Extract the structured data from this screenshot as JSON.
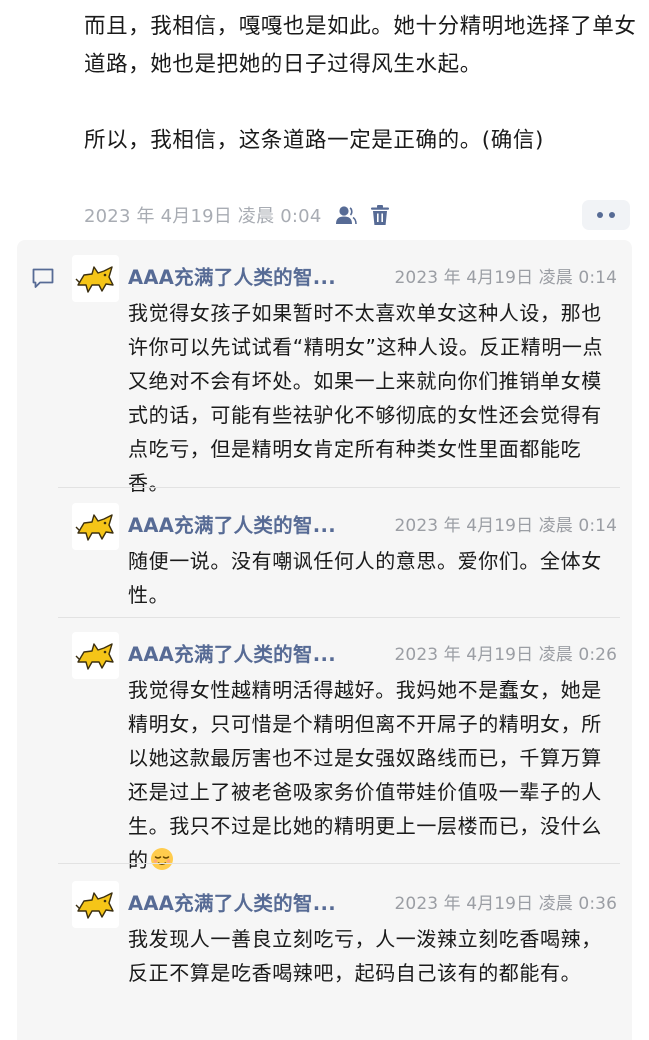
{
  "post": {
    "paragraph_1": "而且，我相信，嘎嘎也是如此。她十分精明地选择了单女道路，她也是把她的日子过得风生水起。",
    "paragraph_2": "所以，我相信，这条道路一定是正确的。(确信)",
    "timestamp": "2023 年 4月19日 凌晨 0:04",
    "icons": [
      "person-icon",
      "trash-icon",
      "more-icon"
    ]
  },
  "comments_section": {
    "icon": "comment-icon",
    "comments": [
      {
        "author": "AAA充满了人类的智...",
        "time": "2023 年 4月19日 凌晨 0:14",
        "text": "我觉得女孩子如果暂时不太喜欢单女这种人设，那也许你可以先试试看“精明女”这种人设。反正精明一点又绝对不会有坏处。如果一上来就向你们推销单女模式的话，可能有些祛驴化不够彻底的女性还会觉得有点吃亏，但是精明女肯定所有种类女性里面都能吃香。"
      },
      {
        "author": "AAA充满了人类的智...",
        "time": "2023 年 4月19日 凌晨 0:14",
        "text": "随便一说。没有嘲讽任何人的意思。爱你们。全体女性。"
      },
      {
        "author": "AAA充满了人类的智...",
        "time": "2023 年 4月19日 凌晨 0:26",
        "text": "我觉得女性越精明活得越好。我妈她不是蠢女，她是精明女，只可惜是个精明但离不开屌子的精明女，所以她这款最厉害也不过是女强奴路线而已，千算万算还是过上了被老爸吸家务价值带娃价值吸一辈子的人生。我只不过是比她的精明更上一层楼而已，没什么的",
        "emoji": "relieved-face-emoji"
      },
      {
        "author": "AAA充满了人类的智...",
        "time": "2023 年 4月19日 凌晨 0:36",
        "text": "我发现人一善良立刻吃亏，人一泼辣立刻吃香喝辣，反正不算是吃香喝辣吧，起码自己该有的都能有。"
      }
    ]
  },
  "colors": {
    "link_blue": "#576b95",
    "meta_gray": "#a8acb3",
    "comment_bg": "#f6f6f6",
    "avatar_yellow": "#f5c518"
  }
}
